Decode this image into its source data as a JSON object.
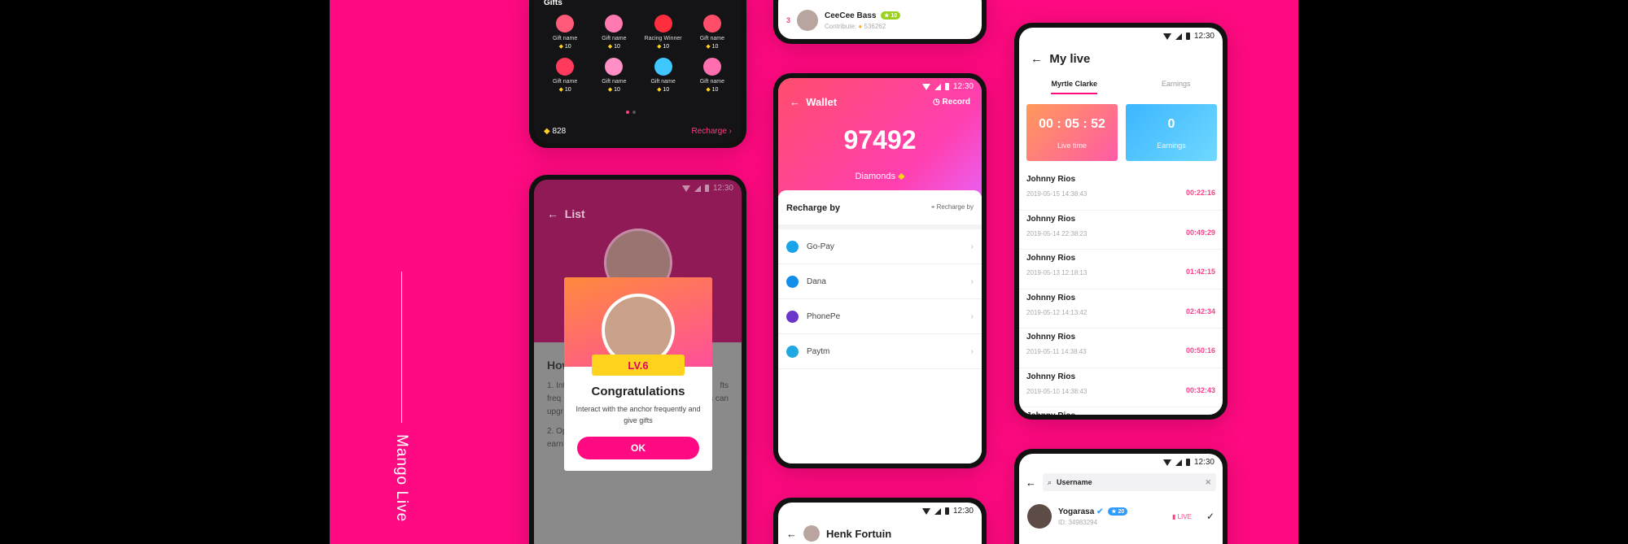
{
  "brand": {
    "name": "Mango Live"
  },
  "colors": {
    "accent": "#ff0a82",
    "gold": "#ffd21e"
  },
  "gifts": {
    "title": "Gifts",
    "items": [
      {
        "name": "Gift name",
        "price": "10",
        "icon": "balloon-gift-icon",
        "color": "#ff5a7a"
      },
      {
        "name": "Gift name",
        "price": "10",
        "icon": "rocket-gift-icon",
        "color": "#ff7ab0"
      },
      {
        "name": "Racing Winner",
        "price": "10",
        "icon": "balloon-gift-icon",
        "color": "#ff2e3e"
      },
      {
        "name": "Gift name",
        "price": "10",
        "icon": "lips-gift-icon",
        "color": "#ff4d6a"
      },
      {
        "name": "Gift name",
        "price": "10",
        "icon": "love-gift-icon",
        "color": "#ff3a5c"
      },
      {
        "name": "Gift name",
        "price": "10",
        "icon": "flower-gift-icon",
        "color": "#ff8fc4"
      },
      {
        "name": "Gift name",
        "price": "10",
        "icon": "diamond-gift-icon",
        "color": "#3ec8ff"
      },
      {
        "name": "Gift name",
        "price": "10",
        "icon": "hearts-gift-icon",
        "color": "#ff6fb0"
      }
    ],
    "balance": "828",
    "recharge": "Recharge"
  },
  "list": {
    "title": "List",
    "how": "How",
    "body1": "1. Int",
    "body1b": "fts",
    "body1c": "freq",
    "body1d": "s can",
    "body1e": "upgr",
    "body2": "2. Op",
    "body2b": "earn"
  },
  "congrats": {
    "level": "LV.6",
    "title": "Congratulations",
    "text": "Interact with the anchor frequently and give gifts",
    "ok": "OK"
  },
  "contributor": {
    "rank": "3",
    "name": "CeeCee Bass",
    "level": "10",
    "contribute": "Contribute:",
    "amount": "536262"
  },
  "wallet": {
    "title": "Wallet",
    "record": "Record",
    "amount": "97492",
    "unit": "Diamonds",
    "recharge_by": "Recharge by",
    "recharge_by_sub": "Recharge by",
    "methods": [
      {
        "name": "Go-Pay",
        "color": "#1aa3e8"
      },
      {
        "name": "Dana",
        "color": "#118eea"
      },
      {
        "name": "PhonePe",
        "color": "#6a35c8"
      },
      {
        "name": "Paytm",
        "color": "#20a8e0"
      }
    ]
  },
  "henk": {
    "name": "Henk Fortuin"
  },
  "mylive": {
    "title": "My live",
    "tabs": [
      "Myrtle Clarke",
      "Earnings"
    ],
    "live_time": "00 : 05 : 52",
    "live_time_label": "Live time",
    "earnings": "0",
    "earnings_label": "Earnings",
    "records": [
      {
        "name": "Johnny Rios",
        "date": "2019-05-15 14:38:43",
        "dur": "00:22:16"
      },
      {
        "name": "Johnny Rios",
        "date": "2019-05-14 22:38:23",
        "dur": "00:49:29"
      },
      {
        "name": "Johnny Rios",
        "date": "2019-05-13 12:18:13",
        "dur": "01:42:15"
      },
      {
        "name": "Johnny Rios",
        "date": "2019-05-12 14:13:42",
        "dur": "02:42:34"
      },
      {
        "name": "Johnny Rios",
        "date": "2019-05-11 14:38:43",
        "dur": "00:50:16"
      },
      {
        "name": "Johnny Rios",
        "date": "2019-05-10 14:38:43",
        "dur": "00:32:43"
      },
      {
        "name": "Johnny Rios",
        "date": "",
        "dur": ""
      }
    ]
  },
  "search": {
    "query": "Username",
    "result": {
      "name": "Yogarasa",
      "level": "20",
      "id": "ID: 34983294",
      "live": "LIVE"
    }
  },
  "status": {
    "time": "12:30"
  }
}
